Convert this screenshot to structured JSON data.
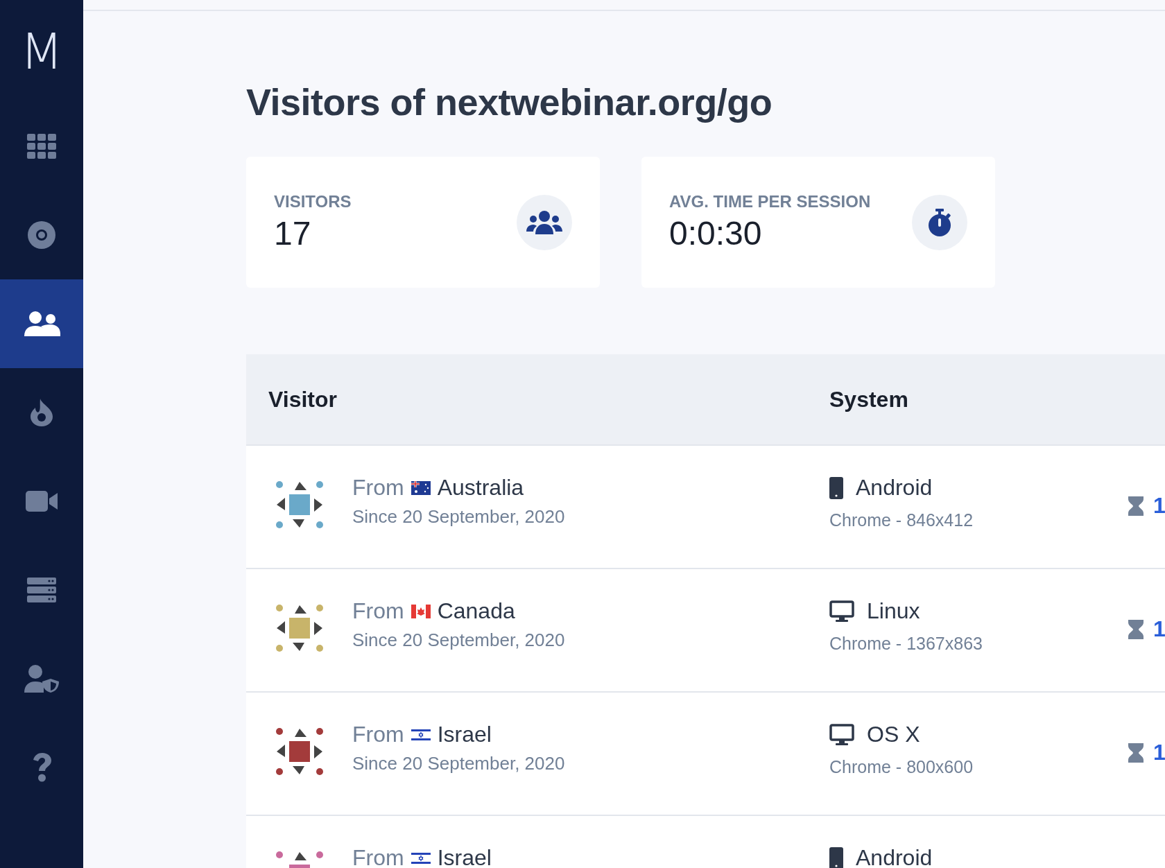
{
  "sidebar": {
    "logo": "M",
    "items": [
      {
        "kind": "grid",
        "selected": false
      },
      {
        "kind": "disc",
        "selected": false
      },
      {
        "kind": "people",
        "selected": true
      },
      {
        "kind": "flame",
        "selected": false
      },
      {
        "kind": "video",
        "selected": false
      },
      {
        "kind": "server",
        "selected": false
      },
      {
        "kind": "user-shield",
        "selected": false
      },
      {
        "kind": "help",
        "selected": false
      }
    ]
  },
  "title": "Visitors of nextwebinar.org/go",
  "stats": [
    {
      "label": "VISITORS",
      "value": "17",
      "kind": "people"
    },
    {
      "label": "AVG. TIME PER SESSION",
      "value": "0:0:30",
      "kind": "stopwatch"
    }
  ],
  "table": {
    "columns": [
      "Visitor",
      "System"
    ],
    "rows": [
      {
        "color": "#6aa9c9",
        "prefix": "From",
        "flag": {
          "kind": "au"
        },
        "country": "Australia",
        "since": "Since 20 September, 2020",
        "device": {
          "kind": "phone"
        },
        "os": "Android",
        "browser": "Chrome - 846x412",
        "column_3": "1"
      },
      {
        "color": "#c8b46a",
        "prefix": "From",
        "flag": {
          "kind": "ca"
        },
        "country": "Canada",
        "since": "Since 20 September, 2020",
        "device": {
          "kind": "desktop"
        },
        "os": "Linux",
        "browser": "Chrome - 1367x863",
        "column_3": "1"
      },
      {
        "color": "#a33b3b",
        "prefix": "From",
        "flag": {
          "kind": "il"
        },
        "country": "Israel",
        "since": "Since 20 September, 2020",
        "device": {
          "kind": "desktop"
        },
        "os": "OS X",
        "browser": "Chrome - 800x600",
        "column_3": "1"
      },
      {
        "color": "#c96a9c",
        "prefix": "From",
        "flag": {
          "kind": "il"
        },
        "country": "Israel",
        "device": {
          "kind": "phone"
        },
        "os": "Android"
      }
    ]
  }
}
